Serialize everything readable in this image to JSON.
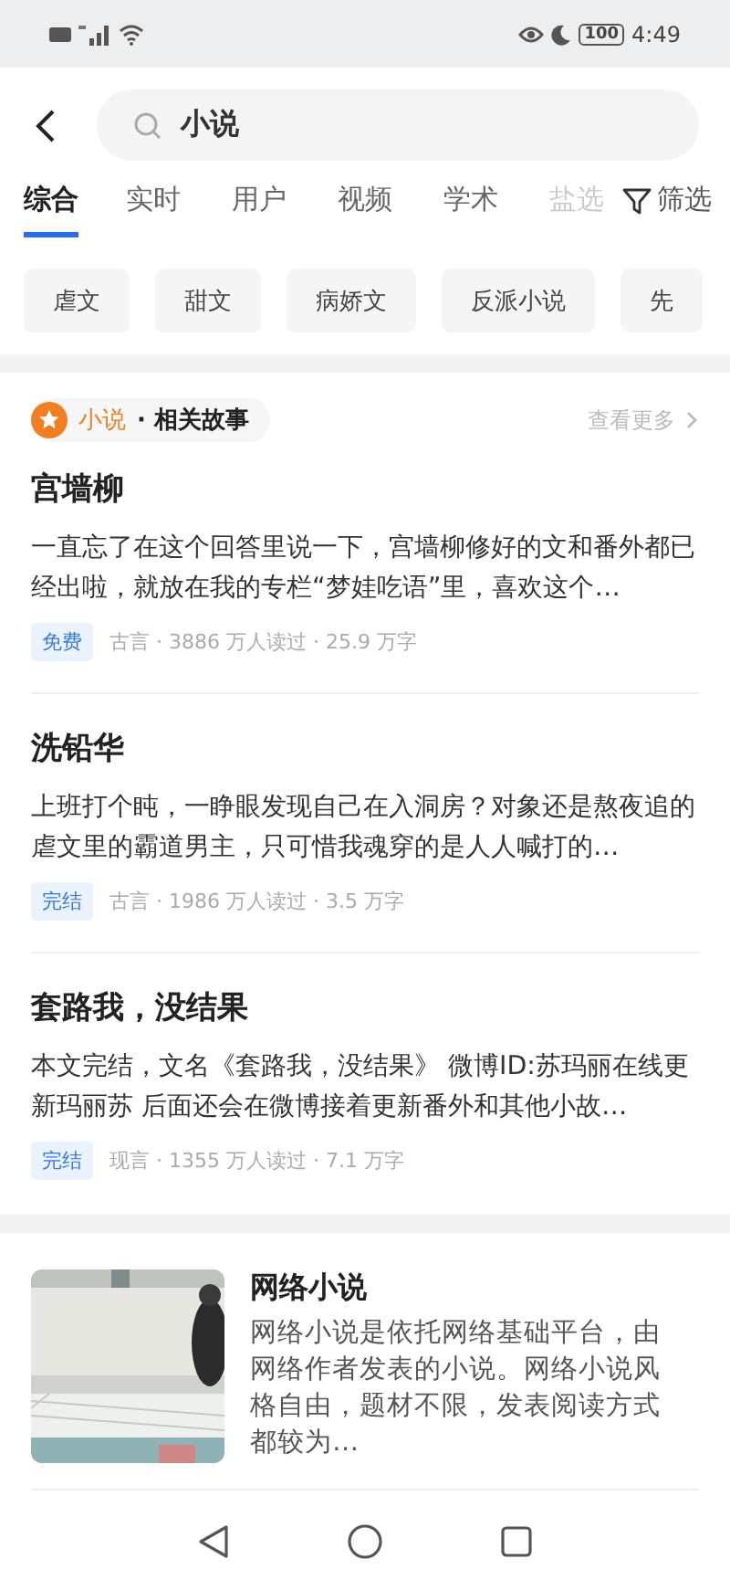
{
  "status_bar": {
    "time": "4:49",
    "battery": "100"
  },
  "search": {
    "value": "小说"
  },
  "tabs": [
    {
      "label": "综合",
      "selected": true
    },
    {
      "label": "实时",
      "selected": false
    },
    {
      "label": "用户",
      "selected": false
    },
    {
      "label": "视频",
      "selected": false
    },
    {
      "label": "学术",
      "selected": false
    },
    {
      "label": "盐选",
      "selected": false
    }
  ],
  "filter": {
    "label": "筛选"
  },
  "chips": [
    "虐文",
    "甜文",
    "病娇文",
    "反派小说",
    "先"
  ],
  "stories": {
    "topic": "小说",
    "separator": "·",
    "title": "相关故事",
    "more": "查看更多",
    "items": [
      {
        "title": "宫墙柳",
        "excerpt": "一直忘了在这个回答里说一下，宫墙柳修好的文和番外都已经出啦，就放在我的专栏“梦娃吃语”里，喜欢这个…",
        "tag": "免费",
        "meta": "古言 · 3886 万人读过 · 25.9 万字"
      },
      {
        "title": "洗铅华",
        "excerpt": "上班打个盹，一睁眼发现自己在入洞房？对象还是熬夜追的虐文里的霸道男主，只可惜我魂穿的是人人喊打的…",
        "tag": "完结",
        "meta": "古言 · 1986 万人读过 · 3.5 万字"
      },
      {
        "title": "套路我，没结果",
        "excerpt": "本文完结，文名《套路我，没结果》 微博ID:苏玛丽在线更新玛丽苏 后面还会在微博接着更新番外和其他小故…",
        "tag": "完结",
        "meta": "现言 · 1355 万人读过 · 7.1 万字"
      }
    ]
  },
  "wiki": {
    "title": "网络小说",
    "summary": "网络小说是依托网络基础平台，由网络作者发表的小说。网络小说风格自由，题材不限，发表阅读方式都较为…"
  }
}
